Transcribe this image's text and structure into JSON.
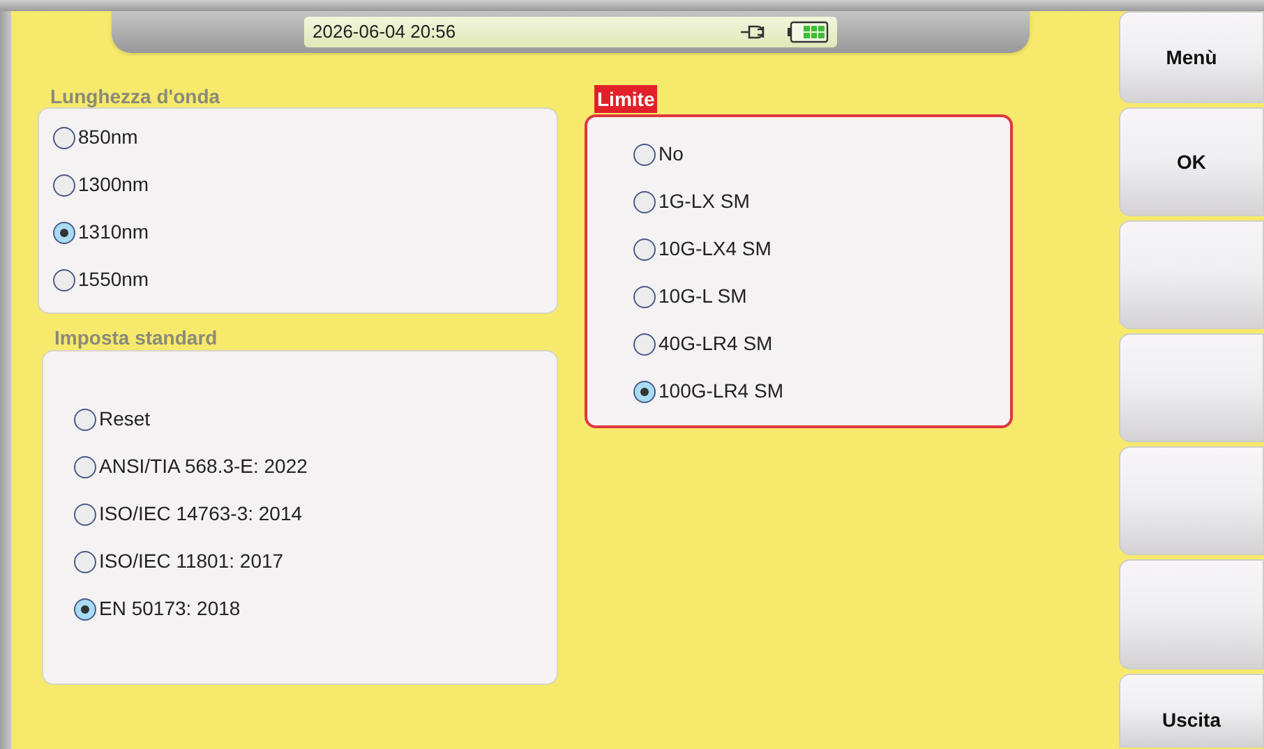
{
  "status_bar": {
    "datetime": "2026-06-04 20:56"
  },
  "wavelength": {
    "title": "Lunghezza d'onda",
    "options": [
      {
        "label": "850nm",
        "selected": false
      },
      {
        "label": "1300nm",
        "selected": false
      },
      {
        "label": "1310nm",
        "selected": true
      },
      {
        "label": "1550nm",
        "selected": false
      }
    ]
  },
  "standard": {
    "title": "Imposta standard",
    "options": [
      {
        "label": "Reset",
        "selected": false
      },
      {
        "label": "ANSI/TIA 568.3-E: 2022",
        "selected": false
      },
      {
        "label": "ISO/IEC 14763-3: 2014",
        "selected": false
      },
      {
        "label": "ISO/IEC 11801: 2017",
        "selected": false
      },
      {
        "label": "EN 50173: 2018",
        "selected": true
      }
    ]
  },
  "limit": {
    "title": "Limite",
    "options": [
      {
        "label": "No",
        "selected": false
      },
      {
        "label": "1G-LX SM",
        "selected": false
      },
      {
        "label": "10G-LX4 SM",
        "selected": false
      },
      {
        "label": "10G-L SM",
        "selected": false
      },
      {
        "label": "40G-LR4 SM",
        "selected": false
      },
      {
        "label": "100G-LR4 SM",
        "selected": true
      }
    ]
  },
  "side_buttons": [
    {
      "kind": "label",
      "label": "Menù"
    },
    {
      "kind": "label",
      "label": "OK"
    },
    {
      "kind": "blank"
    },
    {
      "kind": "blank"
    },
    {
      "kind": "blank"
    },
    {
      "kind": "blank"
    },
    {
      "kind": "label",
      "label": "Uscita"
    }
  ]
}
